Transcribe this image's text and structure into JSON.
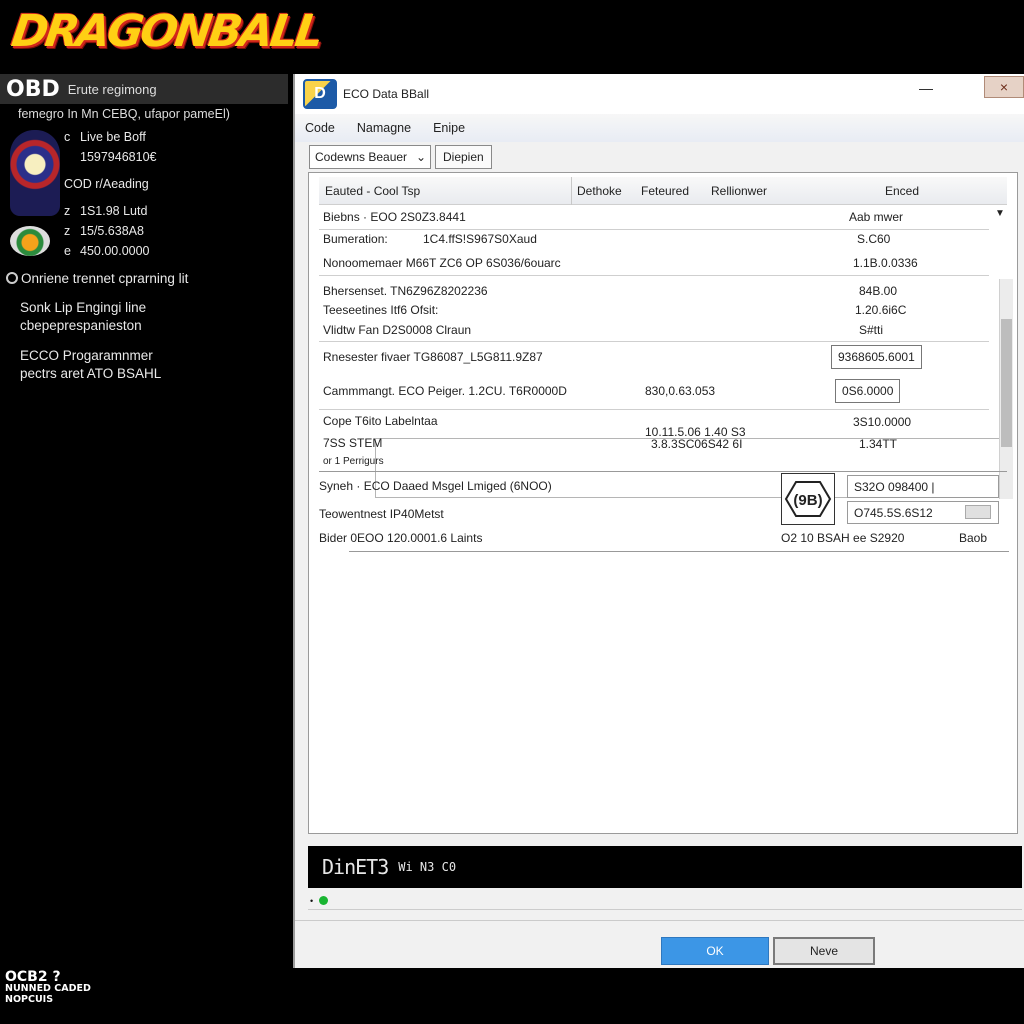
{
  "banner": {
    "logo": "DRAGONBALL"
  },
  "sidebar": {
    "header_logo": "OBD",
    "header_text": "Erute regimong",
    "subtitle": "femegro In Mn CEBQ, ufapor pameEl)",
    "lines": [
      {
        "bullet": "c",
        "text": "Live be Boff"
      },
      {
        "bullet": "",
        "text": "1597946810€"
      },
      {
        "bullet": "",
        "text": "COD r/Aeading"
      },
      {
        "bullet": "z",
        "text": "1S1.98 Lutd"
      },
      {
        "bullet": "z",
        "text": "15/5.638A8"
      },
      {
        "bullet": "e",
        "text": "450.00.0000"
      }
    ],
    "section_title": "Onriene trennet cprarning lit",
    "para1": [
      "Sonk Lip Engingi line",
      "cbepeprespanieston"
    ],
    "para2": [
      "ECCO Progaramnmer",
      "pectrs aret ATO BSAHL"
    ]
  },
  "window": {
    "title": "ECO Data BBall",
    "minimize": "—",
    "close": "×",
    "menu": [
      "Code",
      "Namagne",
      "Enipe"
    ],
    "dropdown_value": "Codewns Beauer",
    "tab_button": "Diepien",
    "grid_headers": [
      "Eauted - Cool Tsp",
      "Dethoke",
      "Feteured",
      "Rellionwer",
      "Enced"
    ],
    "grid_rows": [
      {
        "key": "Biebns  · EOO 2S0Z3.8441",
        "mid": "",
        "val": "Aab mwer"
      },
      {
        "key": "Bumeration:",
        "mid": "1C4.ffS!S967S0Xaud",
        "val": "S.C60"
      },
      {
        "key": "Nonoomemaer M66T ZC6 OP 6S036/6ouarc",
        "mid": "",
        "val": "1.1B.0.0336"
      },
      {
        "key": "Bhersenset. TN6Z96Z8202236",
        "mid": "",
        "val": "84B.00"
      },
      {
        "key": "Teeseetines Itf6 Ofsit:",
        "mid": "",
        "val": "1.20.6i6C"
      },
      {
        "key": "Vlidtw Fan D2S0008 Clraun",
        "mid": "",
        "val": "S#tti"
      },
      {
        "key": "Rnesester fivaer   TG86087_L5G811.9Z87",
        "mid": "",
        "val": "9368605.6001"
      },
      {
        "key": "Cammmangt. ECO Peiger. 1.2CU. T6R0000D",
        "mid": "830,0.63.053",
        "val": "0S6.0000"
      },
      {
        "key": "Cope T6ito  Labelntaa",
        "mid": "10.11.5.06 1.40 S3",
        "val": "3S10.0000"
      },
      {
        "key": "7SS   STEM",
        "mid": "3.8.3SC06S42 6I",
        "val": "1.34TT"
      },
      {
        "key": "or   1 Perrigurs",
        "mid": "",
        "val": ""
      }
    ],
    "summary": {
      "line1": "Syneh · ECO Daaed Msgel Lmiged (6NOO)",
      "line2": "Teowentnest IP40Metst",
      "line3": "Bider 0EOO 120.0001.6 Laints",
      "hex_label": "(9B)",
      "input1": "S32O 098400 |",
      "input2": "O745.5S.6S12",
      "footer_left": "O2 10  BSAH ee S2920",
      "footer_right": "Baob"
    },
    "console_text": "DinET3",
    "console_small": "Wi N3 C0",
    "ok_button": "OK",
    "next_button": "Neve"
  },
  "bottom": {
    "l1": "OCB2 ?",
    "l2": "NUNNED CADED",
    "l3": "NOPCUIS"
  },
  "colors": {
    "accent": "#3c96e6",
    "status": "#19b532",
    "logo_yellow": "#ffcf14",
    "logo_red": "#d2261b"
  }
}
